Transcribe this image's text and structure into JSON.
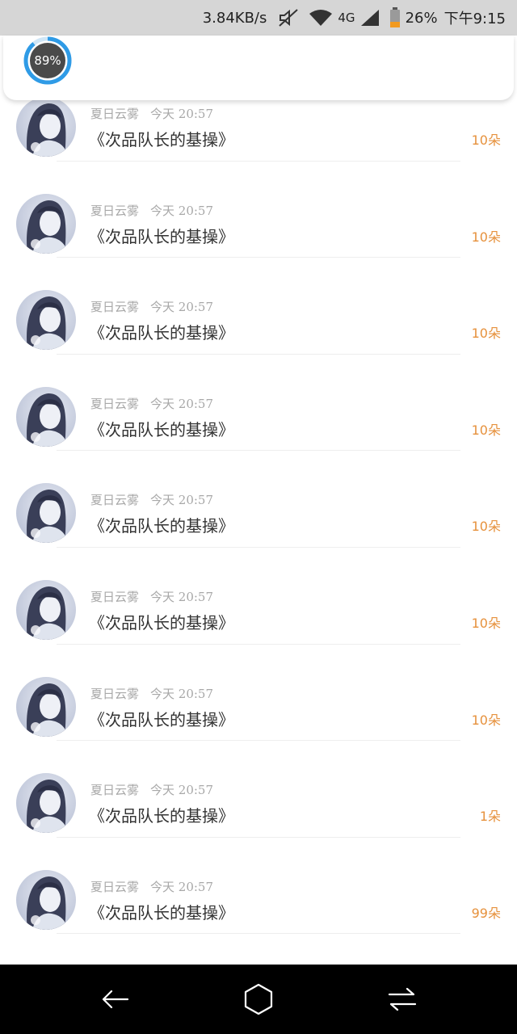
{
  "status_bar": {
    "net_speed": "3.84KB/s",
    "network_type": "4G",
    "battery_percent": "26%",
    "clock": "下午9:15",
    "icons": [
      "mute-icon",
      "wifi-icon",
      "signal-icon",
      "battery-icon"
    ]
  },
  "progress": {
    "value": 0.89,
    "label": "89%"
  },
  "colors": {
    "accent": "#e6913c",
    "ring": "#2f9be6"
  },
  "items": [
    {
      "user": "夏日云雾",
      "time": "今天 20:57",
      "title": "《次品队长的基操》",
      "amount": "10朵"
    },
    {
      "user": "夏日云雾",
      "time": "今天 20:57",
      "title": "《次品队长的基操》",
      "amount": "10朵"
    },
    {
      "user": "夏日云雾",
      "time": "今天 20:57",
      "title": "《次品队长的基操》",
      "amount": "10朵"
    },
    {
      "user": "夏日云雾",
      "time": "今天 20:57",
      "title": "《次品队长的基操》",
      "amount": "10朵"
    },
    {
      "user": "夏日云雾",
      "time": "今天 20:57",
      "title": "《次品队长的基操》",
      "amount": "10朵"
    },
    {
      "user": "夏日云雾",
      "time": "今天 20:57",
      "title": "《次品队长的基操》",
      "amount": "10朵"
    },
    {
      "user": "夏日云雾",
      "time": "今天 20:57",
      "title": "《次品队长的基操》",
      "amount": "10朵"
    },
    {
      "user": "夏日云雾",
      "time": "今天 20:57",
      "title": "《次品队长的基操》",
      "amount": "1朵"
    },
    {
      "user": "夏日云雾",
      "time": "今天 20:57",
      "title": "《次品队长的基操》",
      "amount": "99朵"
    }
  ],
  "nav": {
    "buttons": [
      "back-icon",
      "home-icon",
      "recents-icon"
    ]
  }
}
